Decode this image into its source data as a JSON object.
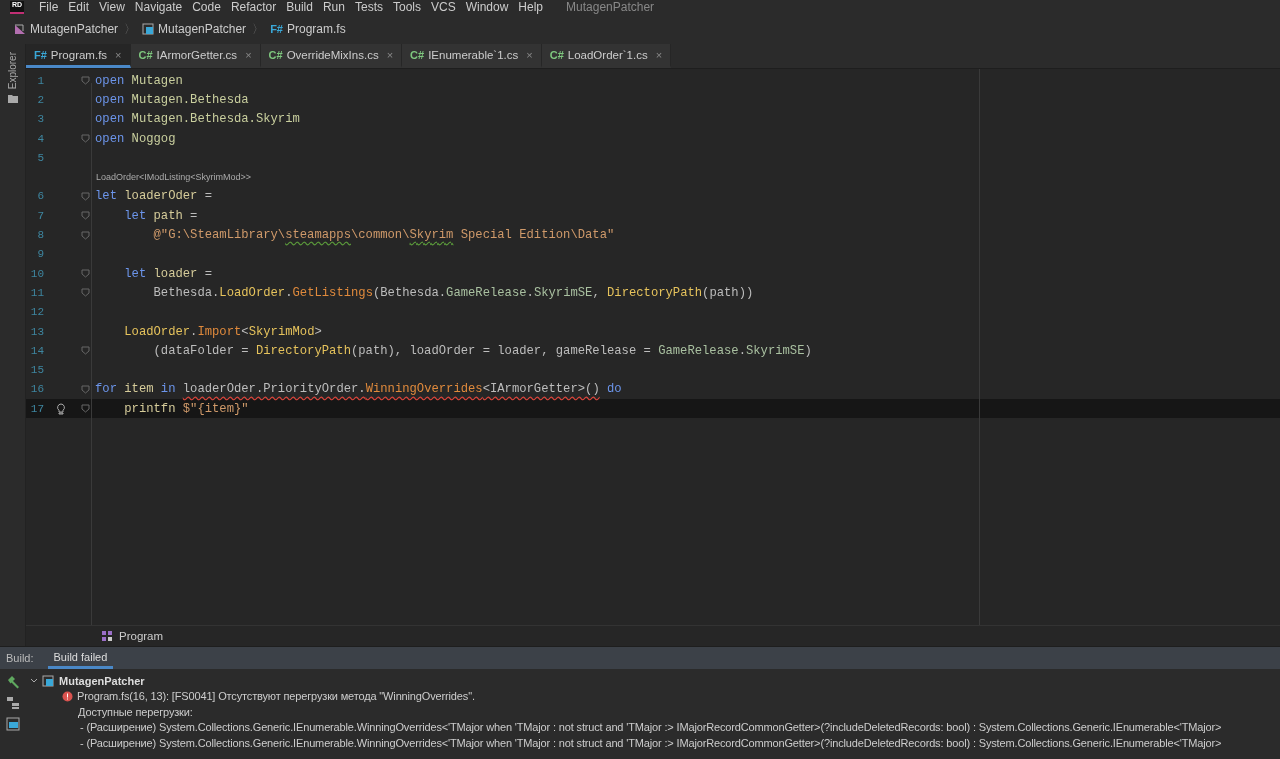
{
  "app_logo": "RD",
  "menu": [
    "File",
    "Edit",
    "View",
    "Navigate",
    "Code",
    "Refactor",
    "Build",
    "Run",
    "Tests",
    "Tools",
    "VCS",
    "Window",
    "Help"
  ],
  "window_title": "MutagenPatcher",
  "breadcrumbs": [
    {
      "kind": "solution",
      "label": "MutagenPatcher"
    },
    {
      "kind": "project",
      "separator": "〉",
      "label": "MutagenPatcher"
    },
    {
      "kind": "fsharp",
      "separator": "〉",
      "badge": "F#",
      "label": "Program.fs"
    }
  ],
  "side_tool": "Explorer",
  "tabs": [
    {
      "badge": "F#",
      "kind": "fsharp",
      "label": "Program.fs",
      "close": "×",
      "selected": true
    },
    {
      "badge": "C#",
      "kind": "csharp",
      "label": "IArmorGetter.cs",
      "close": "×",
      "selected": false
    },
    {
      "badge": "C#",
      "kind": "csharp",
      "label": "OverrideMixIns.cs",
      "close": "×",
      "selected": false
    },
    {
      "badge": "C#",
      "kind": "csharp",
      "label": "IEnumerable`1.cs",
      "close": "×",
      "selected": false
    },
    {
      "badge": "C#",
      "kind": "csharp",
      "label": "LoadOrder`1.cs",
      "close": "×",
      "selected": false
    }
  ],
  "lines": [
    {
      "kind": "code",
      "number": "1",
      "fold": true,
      "current": false,
      "bulb": false,
      "tokens": [
        {
          "t": "open ",
          "kind": "kw"
        },
        {
          "t": "Mutagen",
          "kind": "ns"
        }
      ]
    },
    {
      "kind": "code",
      "number": "2",
      "fold": false,
      "current": false,
      "bulb": false,
      "tokens": [
        {
          "t": "open ",
          "kind": "kw"
        },
        {
          "t": "Mutagen.Bethesda",
          "kind": "ns"
        }
      ]
    },
    {
      "kind": "code",
      "number": "3",
      "fold": false,
      "current": false,
      "bulb": false,
      "tokens": [
        {
          "t": "open ",
          "kind": "kw"
        },
        {
          "t": "Mutagen.Bethesda.Skyrim",
          "kind": "ns"
        }
      ]
    },
    {
      "kind": "code",
      "number": "4",
      "fold": true,
      "current": false,
      "bulb": false,
      "tokens": [
        {
          "t": "open ",
          "kind": "kw"
        },
        {
          "t": "Noggog",
          "kind": "ns"
        }
      ]
    },
    {
      "kind": "code",
      "number": "5",
      "fold": false,
      "current": false,
      "bulb": false
    },
    {
      "kind": "hint",
      "text": "LoadOrder<IModListing<SkyrimMod>>"
    },
    {
      "kind": "code",
      "number": "6",
      "fold": true,
      "current": false,
      "bulb": false,
      "tokens": [
        {
          "t": "let ",
          "kind": "kw"
        },
        {
          "t": "loaderOder",
          "kind": "var"
        },
        {
          "t": " =",
          "kind": "plain"
        }
      ]
    },
    {
      "kind": "code",
      "number": "7",
      "fold": true,
      "current": false,
      "bulb": false,
      "tokens": [
        {
          "t": "    let ",
          "kind": "kw"
        },
        {
          "t": "path",
          "kind": "var"
        },
        {
          "t": " =",
          "kind": "plain"
        }
      ]
    },
    {
      "kind": "code",
      "number": "8",
      "fold": true,
      "current": false,
      "bulb": false,
      "tokens": [
        {
          "t": "        @\"G:\\SteamLibrary\\",
          "kind": "str"
        },
        {
          "t": "steamapps",
          "kind": "str",
          "typo": true
        },
        {
          "t": "\\common\\",
          "kind": "str"
        },
        {
          "t": "Skyrim",
          "kind": "str",
          "typo": true
        },
        {
          "t": " Special Edition\\Data\"",
          "kind": "str"
        }
      ]
    },
    {
      "kind": "code",
      "number": "9",
      "fold": false,
      "current": false,
      "bulb": false
    },
    {
      "kind": "code",
      "number": "10",
      "fold": true,
      "current": false,
      "bulb": false,
      "tokens": [
        {
          "t": "    let ",
          "kind": "kw"
        },
        {
          "t": "loader",
          "kind": "var"
        },
        {
          "t": " =",
          "kind": "plain"
        }
      ]
    },
    {
      "kind": "code",
      "number": "11",
      "fold": true,
      "current": false,
      "bulb": false,
      "tokens": [
        {
          "t": "        Bethesda.",
          "kind": "plain"
        },
        {
          "t": "LoadOrder",
          "kind": "type"
        },
        {
          "t": ".",
          "kind": "plain"
        },
        {
          "t": "GetListings",
          "kind": "method"
        },
        {
          "t": "(Bethesda.",
          "kind": "plain"
        },
        {
          "t": "GameRelease",
          "kind": "prop"
        },
        {
          "t": ".",
          "kind": "plain"
        },
        {
          "t": "SkyrimSE",
          "kind": "prop"
        },
        {
          "t": ", ",
          "kind": "plain"
        },
        {
          "t": "DirectoryPath",
          "kind": "type"
        },
        {
          "t": "(path))",
          "kind": "plain"
        }
      ]
    },
    {
      "kind": "code",
      "number": "12",
      "fold": false,
      "current": false,
      "bulb": false
    },
    {
      "kind": "code",
      "number": "13",
      "fold": false,
      "current": false,
      "bulb": false,
      "tokens": [
        {
          "t": "    LoadOrder",
          "kind": "type"
        },
        {
          "t": ".",
          "kind": "plain"
        },
        {
          "t": "Import",
          "kind": "method"
        },
        {
          "t": "<",
          "kind": "plain"
        },
        {
          "t": "SkyrimMod",
          "kind": "type"
        },
        {
          "t": ">",
          "kind": "plain"
        }
      ]
    },
    {
      "kind": "code",
      "number": "14",
      "fold": true,
      "current": false,
      "bulb": false,
      "tokens": [
        {
          "t": "        (dataFolder = ",
          "kind": "plain"
        },
        {
          "t": "DirectoryPath",
          "kind": "type"
        },
        {
          "t": "(path), loadOrder = loader, gameRelease = ",
          "kind": "plain"
        },
        {
          "t": "GameRelease",
          "kind": "prop"
        },
        {
          "t": ".",
          "kind": "plain"
        },
        {
          "t": "SkyrimSE",
          "kind": "prop"
        },
        {
          "t": ")",
          "kind": "plain"
        }
      ]
    },
    {
      "kind": "code",
      "number": "15",
      "fold": false,
      "current": false,
      "bulb": false
    },
    {
      "kind": "code",
      "number": "16",
      "fold": true,
      "current": false,
      "bulb": false,
      "tokens": [
        {
          "t": "for ",
          "kind": "kw"
        },
        {
          "t": "item",
          "kind": "var"
        },
        {
          "t": " in ",
          "kind": "kw"
        },
        {
          "t": "loaderOder.PriorityOrder.",
          "kind": "plain",
          "error": true
        },
        {
          "t": "WinningOverrides",
          "kind": "method",
          "error": true
        },
        {
          "t": "<IArmorGetter>()",
          "kind": "plain",
          "error": true
        },
        {
          "t": " do",
          "kind": "kw"
        }
      ]
    },
    {
      "kind": "code",
      "number": "17",
      "fold": true,
      "current": true,
      "bulb": true,
      "tokens": [
        {
          "t": "    printfn ",
          "kind": "var"
        },
        {
          "t": "$\"{item}\"",
          "kind": "str"
        }
      ]
    }
  ],
  "structure_path": "Program",
  "build_panel": {
    "label": "Build:",
    "tabs": [
      {
        "label": "Build failed",
        "selected": true
      }
    ],
    "tree": [
      {
        "label": "MutagenPatcher",
        "expanded": true,
        "children": [
          {
            "kind": "error",
            "text": "Program.fs(16, 13): [FS0041] Отсутствуют перегрузки метода \"WinningOverrides\".",
            "details": [
              "Доступные перегрузки:",
              " - (Расширение) System.Collections.Generic.IEnumerable.WinningOverrides<'TMajor when 'TMajor : not struct and 'TMajor :> IMajorRecordCommonGetter>(?includeDeletedRecords: bool) : System.Collections.Generic.IEnumerable<'TMajor>",
              " - (Расширение) System.Collections.Generic.IEnumerable.WinningOverrides<'TMajor when 'TMajor : not struct and 'TMajor :> IMajorRecordCommonGetter>(?includeDeletedRecords: bool) : System.Collections.Generic.IEnumerable<'TMajor>"
            ]
          }
        ]
      }
    ]
  }
}
